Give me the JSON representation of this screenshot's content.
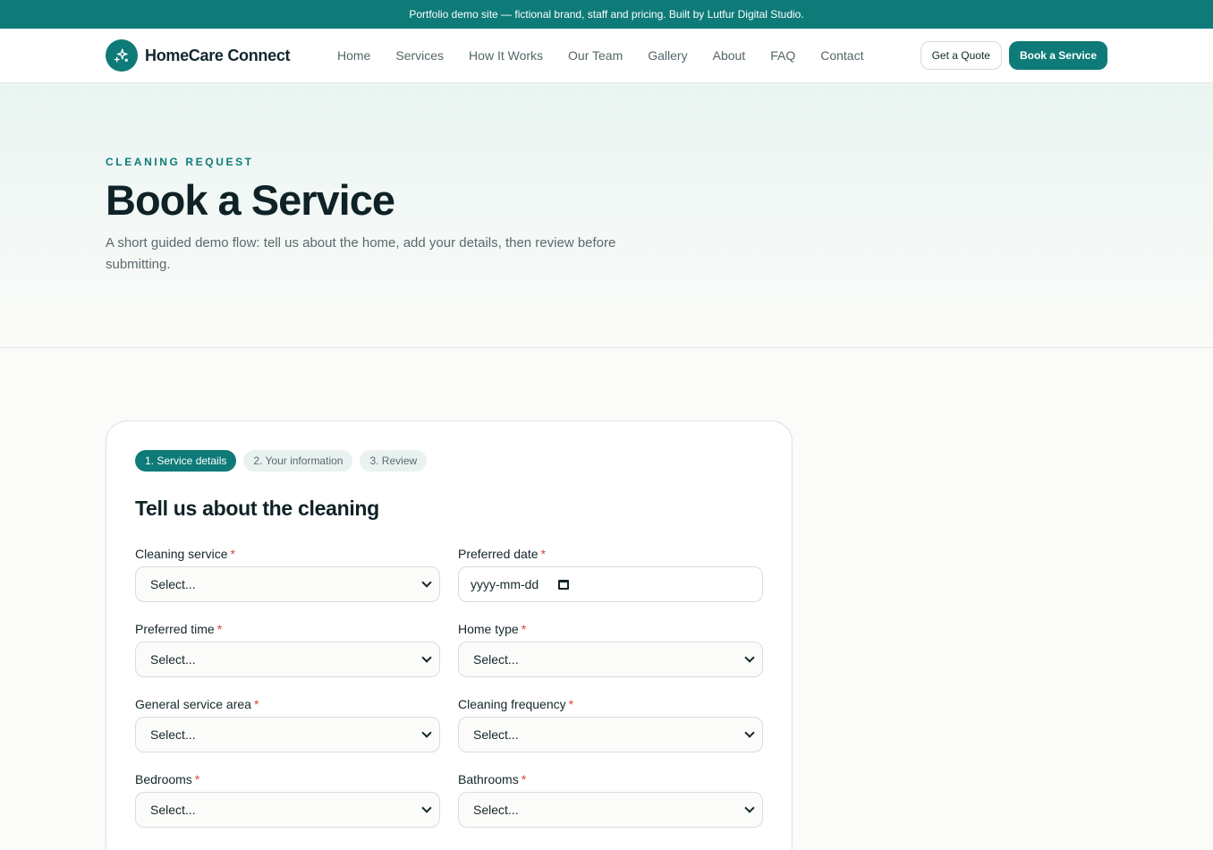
{
  "banner": {
    "text": "Portfolio demo site — fictional brand, staff and pricing. Built by Lutfur Digital Studio."
  },
  "brand": {
    "name": "HomeCare Connect",
    "logo_icon": "sparkle-icon"
  },
  "nav": {
    "items": [
      "Home",
      "Services",
      "How It Works",
      "Our Team",
      "Gallery",
      "About",
      "FAQ",
      "Contact"
    ]
  },
  "header_actions": {
    "quote_label": "Get a Quote",
    "book_label": "Book a Service"
  },
  "hero": {
    "eyebrow": "CLEANING REQUEST",
    "title": "Book a Service",
    "subtitle": "A short guided demo flow: tell us about the home, add your details, then review before submitting."
  },
  "steps": [
    {
      "label": "1. Service details",
      "active": true
    },
    {
      "label": "2. Your information",
      "active": false
    },
    {
      "label": "3. Review",
      "active": false
    }
  ],
  "form": {
    "heading": "Tell us about the cleaning",
    "required_marker": "*",
    "fields": [
      {
        "label": "Cleaning service",
        "value": "Select..."
      },
      {
        "label": "Preferred date",
        "value": "yyyy-mm-dd"
      },
      {
        "label": "Preferred time",
        "value": "Select..."
      },
      {
        "label": "Home type",
        "value": "Select..."
      },
      {
        "label": "General service area",
        "value": "Select..."
      },
      {
        "label": "Cleaning frequency",
        "value": "Select..."
      },
      {
        "label": "Bedrooms",
        "value": "Select..."
      },
      {
        "label": "Bathrooms",
        "value": "Select..."
      }
    ]
  },
  "colors": {
    "brand": "#0f7b78",
    "required": "#d9443b",
    "text": "#0f2226"
  }
}
